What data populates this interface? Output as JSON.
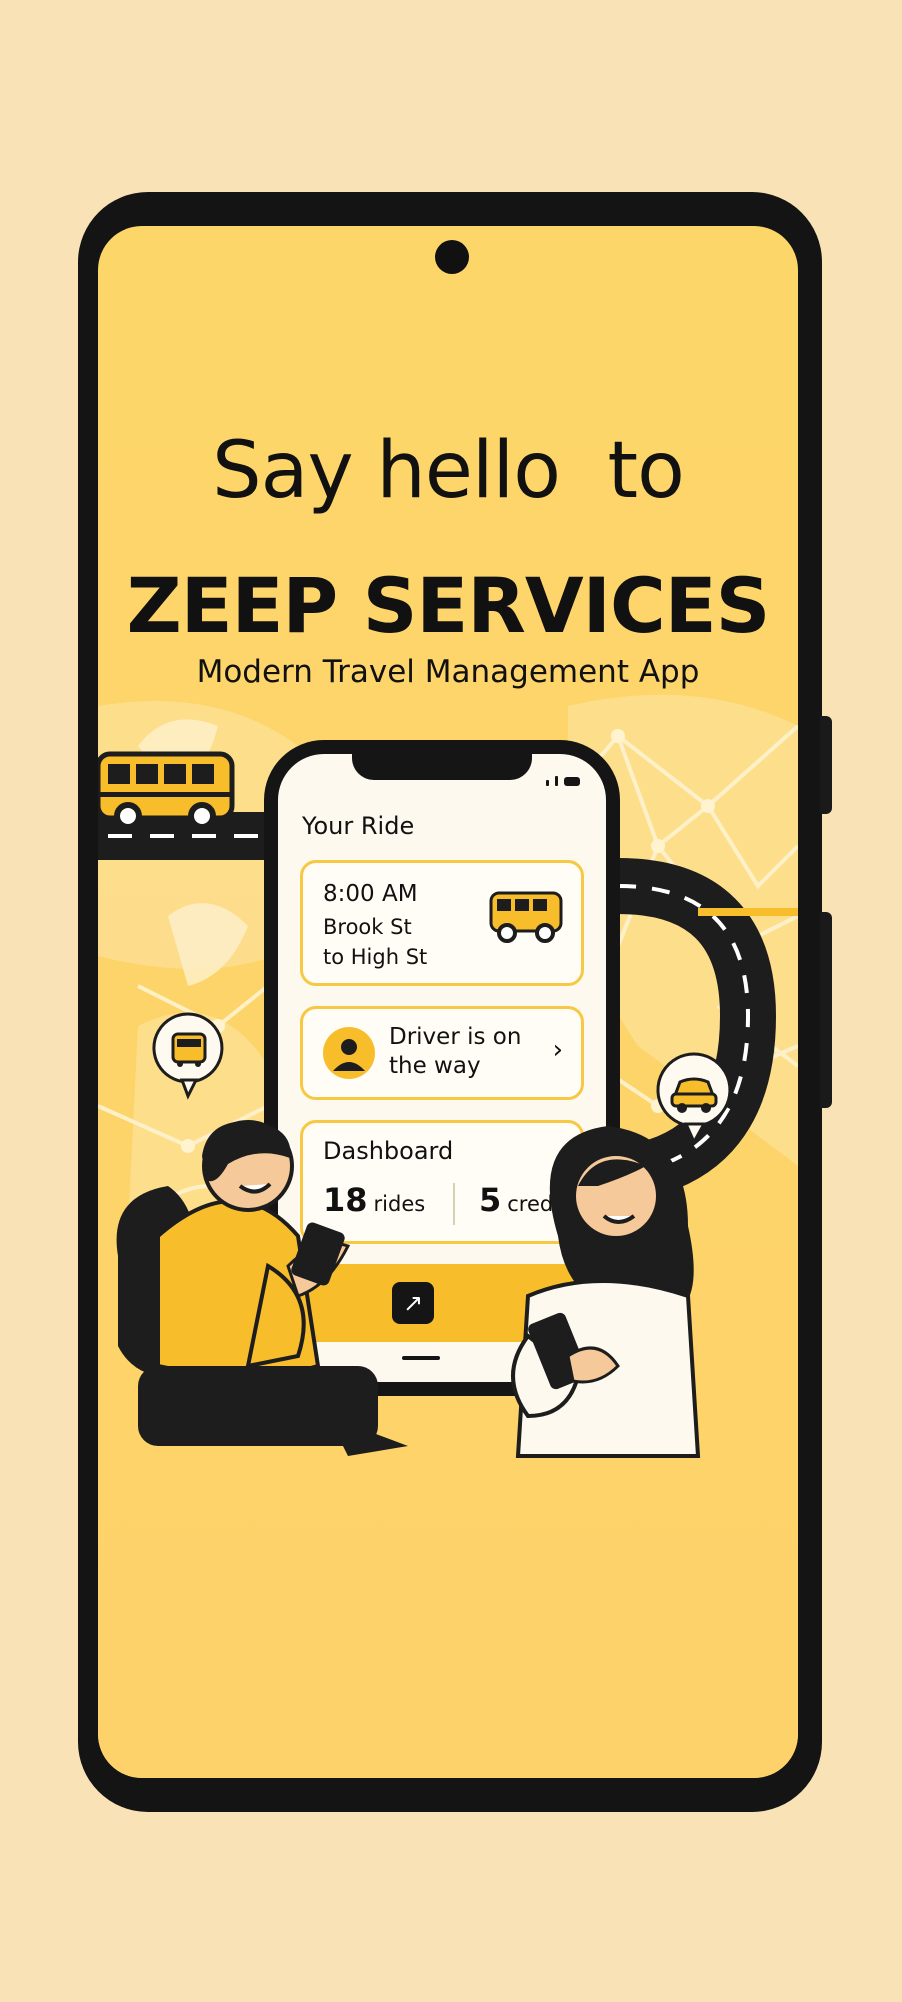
{
  "hero": {
    "greeting": "Say hello  to",
    "brand": "ZEEP SERVICES",
    "tagline": "Modern Travel Management App"
  },
  "app": {
    "section_title": "Your Ride",
    "trip": {
      "time": "8:00 AM",
      "from": "Brook St",
      "to": "to High St",
      "vehicle_icon": "bus-icon"
    },
    "driver_status": {
      "text": "Driver is on the way",
      "avatar_icon": "person-icon",
      "chevron_icon": "chevron-right-icon"
    },
    "dashboard": {
      "title": "Dashboard",
      "rides_value": "18",
      "rides_label": "rides",
      "credits_value": "5",
      "credits_label": "credits"
    },
    "action_button_icon": "external-arrow-icon"
  },
  "illustration": {
    "bubble_left_icon": "bus-icon",
    "bubble_right_icon": "car-icon",
    "bus_icon": "school-bus-icon"
  },
  "colors": {
    "background": "#f9e3b6",
    "screen": "#fdd66a",
    "accent": "#f8bd2b",
    "dark": "#151515",
    "card_border": "#f7c843"
  }
}
